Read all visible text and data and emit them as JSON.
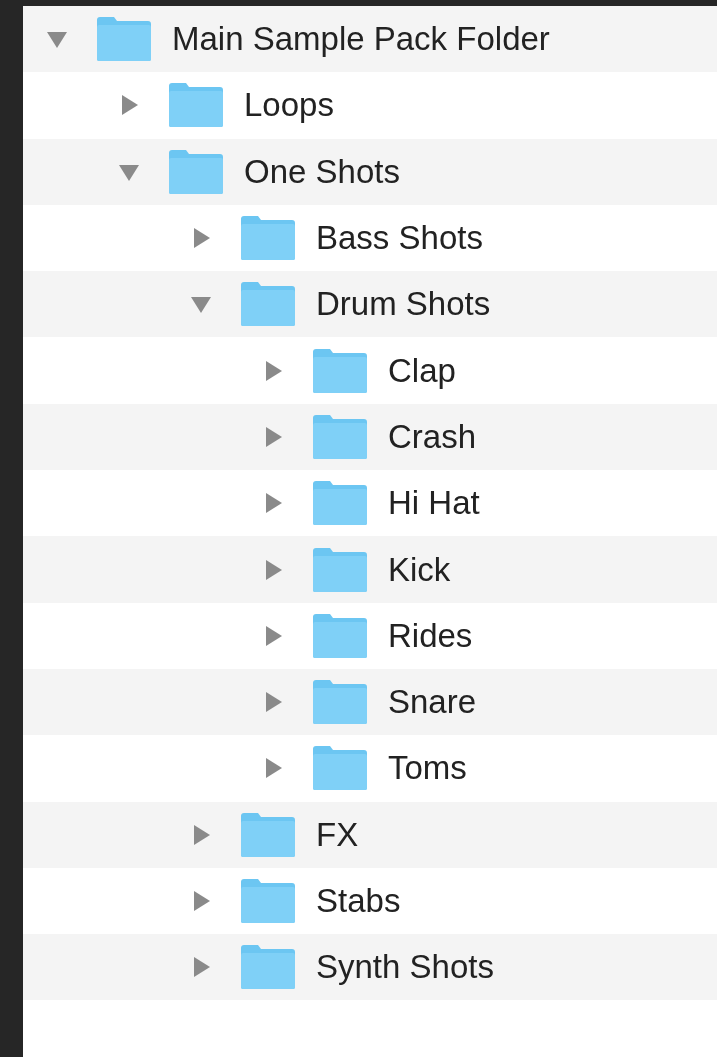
{
  "tree": [
    {
      "label": "Main Sample Pack Folder",
      "expanded": true,
      "children": [
        {
          "label": "Loops",
          "expanded": false
        },
        {
          "label": "One Shots",
          "expanded": true,
          "children": [
            {
              "label": "Bass Shots",
              "expanded": false
            },
            {
              "label": "Drum Shots",
              "expanded": true,
              "children": [
                {
                  "label": "Clap",
                  "expanded": false
                },
                {
                  "label": "Crash",
                  "expanded": false
                },
                {
                  "label": "Hi Hat",
                  "expanded": false
                },
                {
                  "label": "Kick",
                  "expanded": false
                },
                {
                  "label": "Rides",
                  "expanded": false
                },
                {
                  "label": "Snare",
                  "expanded": false
                },
                {
                  "label": "Toms",
                  "expanded": false
                }
              ]
            },
            {
              "label": "FX",
              "expanded": false
            },
            {
              "label": "Stabs",
              "expanded": false
            },
            {
              "label": "Synth Shots",
              "expanded": false
            }
          ]
        }
      ]
    }
  ]
}
